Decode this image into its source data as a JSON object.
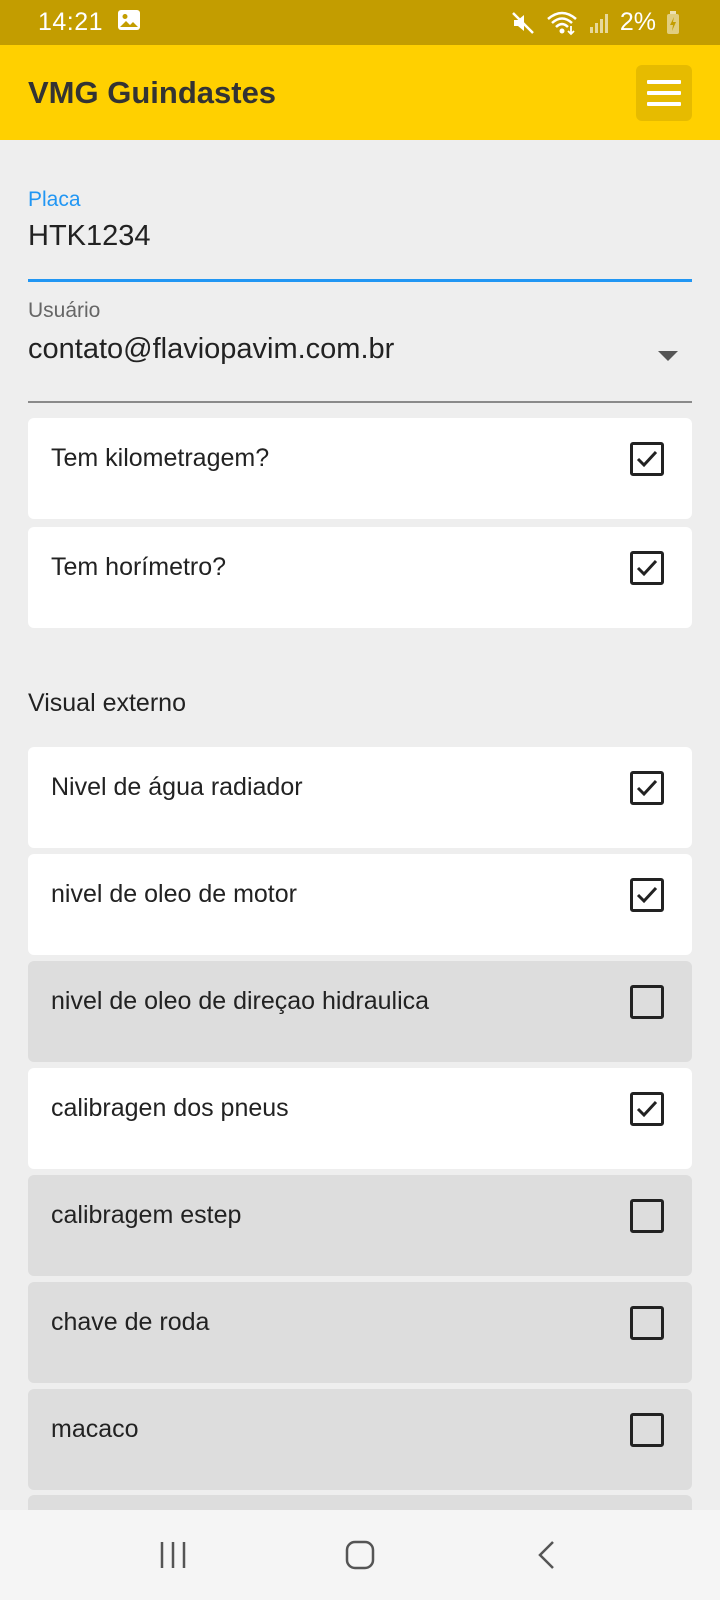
{
  "status_bar": {
    "time": "14:21",
    "battery": "2%",
    "icons": [
      "image-icon",
      "mute-icon",
      "wifi-icon",
      "signal-icon",
      "battery-charging-icon"
    ]
  },
  "app_bar": {
    "title": "VMG Guindastes",
    "menu_icon": "hamburger-icon"
  },
  "form": {
    "placa": {
      "label": "Placa",
      "value": "HTK1234"
    },
    "usuario": {
      "label": "Usuário",
      "value": "contato@flaviopavim.com.br"
    }
  },
  "toggles": [
    {
      "label": "Tem kilometragem?",
      "checked": true
    },
    {
      "label": "Tem horímetro?",
      "checked": true
    }
  ],
  "section": {
    "title": "Visual externo"
  },
  "items": [
    {
      "label": "Nivel de água radiador",
      "checked": true
    },
    {
      "label": "nivel de oleo de motor",
      "checked": true
    },
    {
      "label": "nivel de oleo de direçao hidraulica",
      "checked": false
    },
    {
      "label": "calibragen dos pneus",
      "checked": true
    },
    {
      "label": "calibragem estep",
      "checked": false
    },
    {
      "label": "chave de roda",
      "checked": false
    },
    {
      "label": "macaco",
      "checked": false
    }
  ],
  "colors": {
    "status_bar": "#c39d00",
    "app_bar": "#ffd000",
    "accent": "#2196f3",
    "unchecked_card": "#dddddd"
  },
  "nav_bar": [
    "recents-icon",
    "home-icon",
    "back-icon"
  ]
}
